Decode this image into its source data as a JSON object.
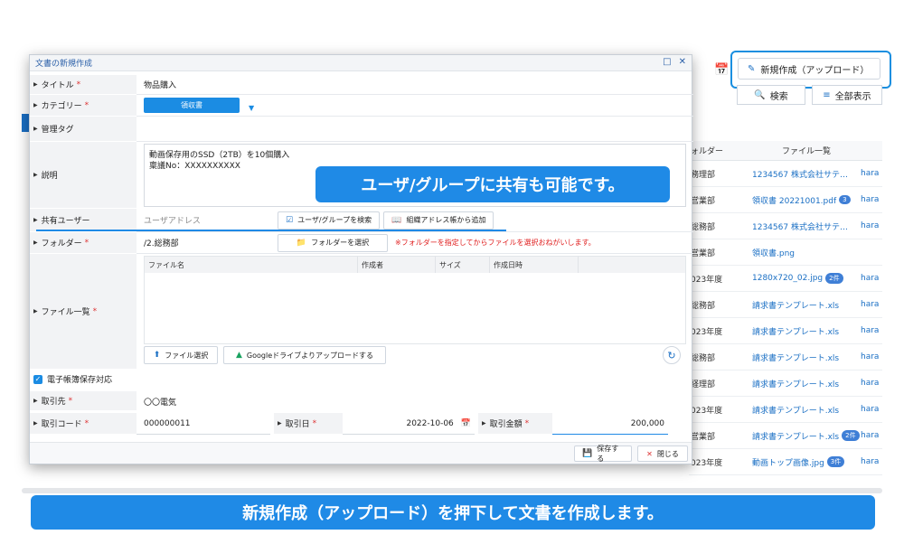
{
  "background": {
    "new_create_label": "新規作成（アップロード）",
    "search_label": "検索",
    "show_all_label": "全部表示",
    "table": {
      "headers": [
        "ォルダー",
        "ファイル一覧",
        ""
      ],
      "rows": [
        {
          "folder": "務理部",
          "file": "1234567 株式会社サテ…",
          "badge": "",
          "user": "hara"
        },
        {
          "folder": "営業部",
          "file": "領収書 20221001.pdf",
          "badge": "3",
          "user": "hara"
        },
        {
          "folder": "総務部",
          "file": "1234567 株式会社サテ…",
          "badge": "",
          "user": "hara"
        },
        {
          "folder": "営業部",
          "file": "領収書.png",
          "badge": "",
          "user": ""
        },
        {
          "folder": "023年度",
          "file": "1280x720_02.jpg",
          "badge": "2件",
          "user": "hara"
        },
        {
          "folder": "総務部",
          "file": "請求書テンプレート.xls",
          "badge": "",
          "user": "hara"
        },
        {
          "folder": "023年度",
          "file": "請求書テンプレート.xls",
          "badge": "",
          "user": "hara"
        },
        {
          "folder": "総務部",
          "file": "請求書テンプレート.xls",
          "badge": "",
          "user": "hara"
        },
        {
          "folder": "経理部",
          "file": "請求書テンプレート.xls",
          "badge": "",
          "user": "hara"
        },
        {
          "folder": "023年度",
          "file": "請求書テンプレート.xls",
          "badge": "",
          "user": "hara"
        },
        {
          "folder": "営業部",
          "file": "請求書テンプレート.xls",
          "badge": "2件",
          "user": "hara"
        },
        {
          "folder": "023年度",
          "file": "動画トップ画像.jpg",
          "badge": "3件",
          "user": "hara"
        }
      ]
    }
  },
  "dialog": {
    "title": "文書の新規作成",
    "fields": {
      "title_label": "タイトル",
      "title_value": "物品購入",
      "category_label": "カテゴリー",
      "category_value": "領収書",
      "tag_label": "管理タグ",
      "desc_label": "説明",
      "desc_line1": "動画保存用のSSD（2TB）を10個購入",
      "desc_line2": "稟議No：XXXXXXXXXX",
      "share_label": "共有ユーザー",
      "share_placeholder": "ユーザアドレス",
      "share_search_btn": "ユーザ/グループを検索",
      "share_add_btn": "組織アドレス帳から追加",
      "folder_label": "フォルダー",
      "folder_value": "/2.総務部",
      "folder_select_btn": "フォルダーを選択",
      "folder_note": "※フォルダーを指定してからファイルを選択おねがいします。",
      "files_label": "ファイル一覧",
      "file_headers": [
        "ファイル名",
        "作成者",
        "サイズ",
        "作成日時"
      ],
      "file_select_btn": "ファイル選択",
      "gdrive_btn": "Googleドライブよりアップロードする",
      "ebook_label": "電子帳簿保存対応",
      "partner_label": "取引先",
      "partner_value": "〇〇電気",
      "code_label": "取引コード",
      "code_value": "000000011",
      "date_label": "取引日",
      "date_value": "2022-10-06",
      "amount_label": "取引金額",
      "amount_value": "200,000"
    },
    "save_btn": "保存する",
    "close_btn": "閉じる"
  },
  "callouts": {
    "share_note": "ユーザ/グループに共有も可能です。",
    "banner": "新規作成（アップロード）を押下して文書を作成します。"
  },
  "colors": {
    "accent": "#1f8ae6",
    "link": "#1a6fc4",
    "warning": "#e02020"
  }
}
